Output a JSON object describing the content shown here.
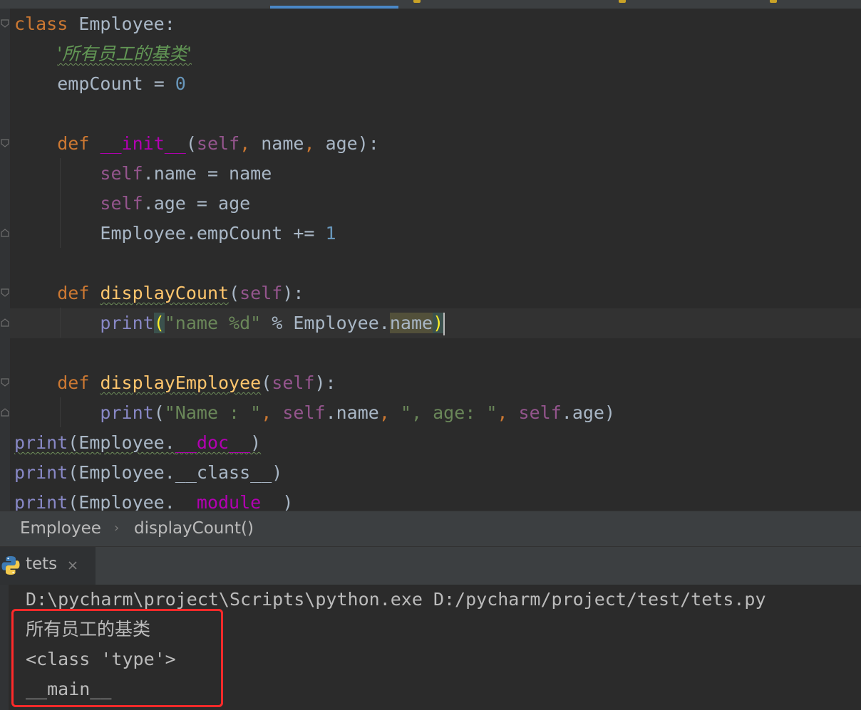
{
  "code": {
    "class_kw": "class",
    "class_name": "Employee",
    "colon": ":",
    "docstring": "'所有员工的基类'",
    "empcount_var": "empCount",
    "assign_op": " = ",
    "empcount_value": "0",
    "def_kw": "def",
    "init_name": "__init__",
    "paren_open": "(",
    "self_kw": "self",
    "comma": ",",
    "init_args_rest": " name",
    "init_arg_age": " age",
    "close_colon": "):",
    "self_name_attr": ".name",
    "self_name_rhs": " = name",
    "self_age_attr": ".age",
    "self_age_rhs": " = age",
    "empcount_inc": "Employee.empCount += ",
    "empcount_inc_value": "1",
    "display_count_name": "displayCount",
    "print_fn": "print",
    "name_format_str": "\"name %d\"",
    "format_op": " % Employee.",
    "name_attr": "name",
    "paren_close": ")",
    "display_employee_name": "displayEmployee",
    "name_label_str": "\"Name : \"",
    "age_label_str": "\", age: \"",
    "dot_name": ".name",
    "dot_age": ".age",
    "employee_dot": "Employee.",
    "doc_attr": "__doc__",
    "class_attr": "__class__",
    "module_attr": "__module__"
  },
  "breadcrumb": {
    "items": [
      "Employee",
      "displayCount()"
    ],
    "separator": "›"
  },
  "run_panel": {
    "tab_label": "tets",
    "close_icon": "close-icon",
    "python_icon": "python-icon"
  },
  "console": {
    "command": "D:\\pycharm\\project\\Scripts\\python.exe D:/pycharm/project/test/tets.py",
    "output": [
      "所有员工的基类",
      "<class 'type'>",
      "__main__"
    ]
  },
  "colors": {
    "keyword": "#cc7832",
    "self": "#94558d",
    "number": "#6897bb",
    "string": "#6a8759",
    "function": "#ffc66d",
    "magic": "#b200b2",
    "builtin": "#8888c6",
    "highlight_box": "#ff2a2a",
    "tab_underline": "#4a88c7"
  }
}
